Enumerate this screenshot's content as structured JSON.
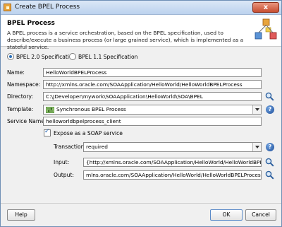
{
  "window": {
    "title": "Create BPEL Process",
    "close_label": "x"
  },
  "header": {
    "title": "BPEL Process",
    "description": "A BPEL process is a service orchestration, based on the BPEL specification, used to describe/execute a business process (or large grained service), which is implemented as a stateful service."
  },
  "spec": {
    "options": [
      {
        "label": "BPEL 2.0 Specification",
        "selected": true
      },
      {
        "label": "BPEL 1.1 Specification",
        "selected": false
      }
    ]
  },
  "form": {
    "name_label": "Name:",
    "name_value": "HelloWorldBPELProcess",
    "namespace_label": "Namespace:",
    "namespace_value": "http://xmlns.oracle.com/SOAApplication/HelloWorld/HelloWorldBPELProcess",
    "directory_label": "Directory:",
    "directory_value": "C:\\JDeveloper\\mywork\\SOAApplication\\HelloWorld\\SOA\\BPEL",
    "template_label": "Template:",
    "template_value": "Synchronous BPEL Process",
    "service_name_label": "Service Name:",
    "service_name_value": "helloworldbpelprocess_client",
    "expose_label": "Expose as a SOAP service",
    "expose_checked": true,
    "transaction_label": "Transaction:",
    "transaction_value": "required",
    "input_label": "Input:",
    "input_value": "{http://xmlns.oracle.com/SOAApplication/HelloWorld/HelloWorldBPELProcess}process",
    "output_label": "Output:",
    "output_value": "mlns.oracle.com/SOAApplication/HelloWorld/HelloWorldBPELProcess}processResponse"
  },
  "footer": {
    "help_label": "Help",
    "ok_label": "OK",
    "cancel_label": "Cancel"
  },
  "icons": {
    "search": "magnifier-icon",
    "help": "help-icon",
    "template": "synchronous-process-icon",
    "logo": "bpel-logo-icon"
  }
}
